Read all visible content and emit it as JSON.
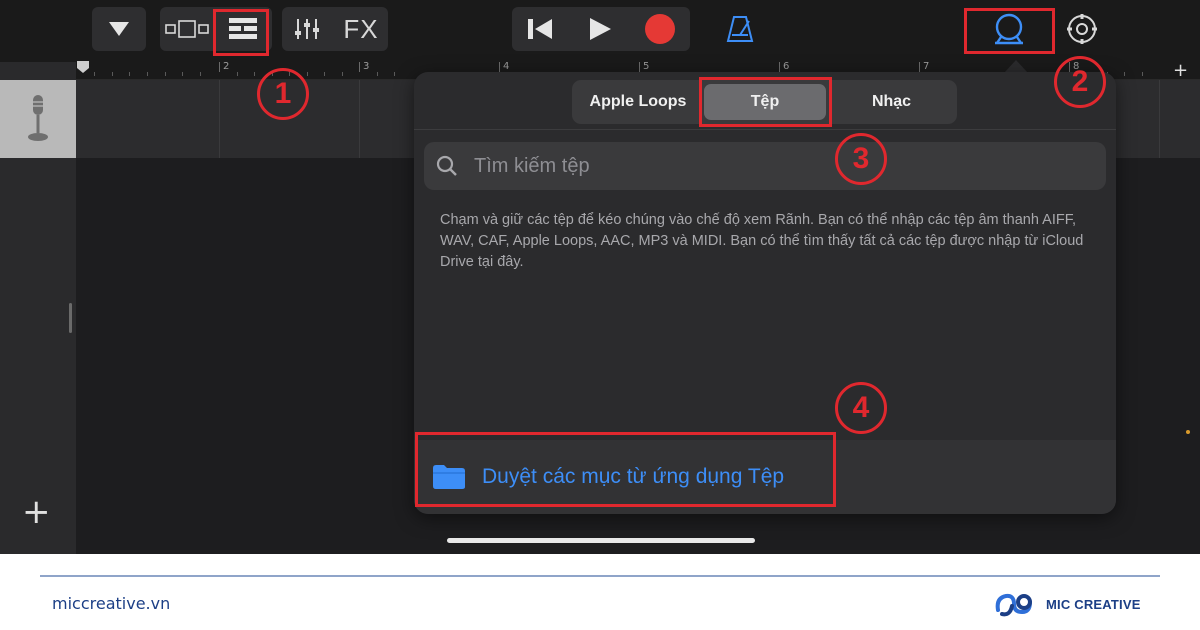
{
  "toolbar": {
    "fx_label": "FX",
    "icons": [
      "dropdown-triangle-icon",
      "view-toggle-icon",
      "tracks-view-icon",
      "mixer-icon",
      "rewind-icon",
      "play-icon",
      "record-icon",
      "metronome-icon",
      "loop-browser-icon",
      "settings-icon"
    ],
    "record_color": "#e53935",
    "metronome_color": "#3d8ef7"
  },
  "ruler": {
    "bar_numbers": [
      "2",
      "3",
      "4",
      "5",
      "6",
      "7",
      "8"
    ]
  },
  "popover": {
    "tabs": [
      {
        "label": "Apple Loops",
        "active": false
      },
      {
        "label": "Tệp",
        "active": true
      },
      {
        "label": "Nhạc",
        "active": false
      }
    ],
    "search": {
      "placeholder": "Tìm kiếm tệp",
      "value": ""
    },
    "help_text": "Chạm và giữ các tệp để kéo chúng vào chế độ xem Rãnh. Bạn có thể nhập các tệp âm thanh AIFF, WAV, CAF, Apple Loops, AAC, MP3 và MIDI. Bạn có thể tìm thấy tất cả các tệp được nhập từ iCloud Drive tại đây.",
    "browse_label": "Duyệt các mục từ ứng dụng Tệp",
    "link_color": "#3d8ef7"
  },
  "tracks": {
    "add_label": "+"
  },
  "annotations": {
    "steps": [
      "1",
      "2",
      "3",
      "4"
    ],
    "color": "#e0282e"
  },
  "footer": {
    "url": "miccreative.vn",
    "brand_name": "MIC CREATIVE",
    "brand_color": "#1c3f86"
  }
}
